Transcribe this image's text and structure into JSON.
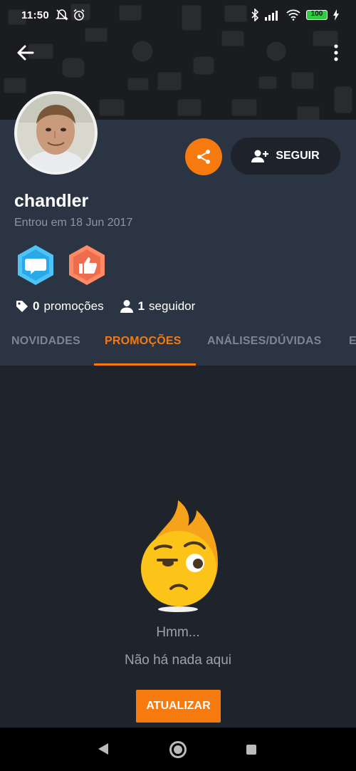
{
  "status_bar": {
    "time": "11:50",
    "battery": "100",
    "icons": [
      "mute-icon",
      "alarm-icon",
      "bluetooth-icon",
      "signal-icon",
      "wifi-icon",
      "battery-icon",
      "charging-icon"
    ]
  },
  "profile": {
    "username": "chandler",
    "joined": "Entrou em 18 Jun 2017",
    "follow_label": "SEGUIR",
    "promotions_count": "0",
    "promotions_label": "promoções",
    "followers_count": "1",
    "followers_label": "seguidor",
    "badges": [
      "comment-badge",
      "like-badge"
    ]
  },
  "tabs": [
    {
      "label": "NOVIDADES",
      "active": false
    },
    {
      "label": "PROMOÇÕES",
      "active": true
    },
    {
      "label": "ANÁLISES/DÚVIDAS",
      "active": false
    },
    {
      "label": "E",
      "active": false
    }
  ],
  "empty_state": {
    "title": "Hmm...",
    "message": "Não há nada aqui",
    "button_label": "ATUALIZAR"
  },
  "colors": {
    "accent": "#f77a0f",
    "background": "#1f232b",
    "profile_bg": "#2b3443"
  }
}
